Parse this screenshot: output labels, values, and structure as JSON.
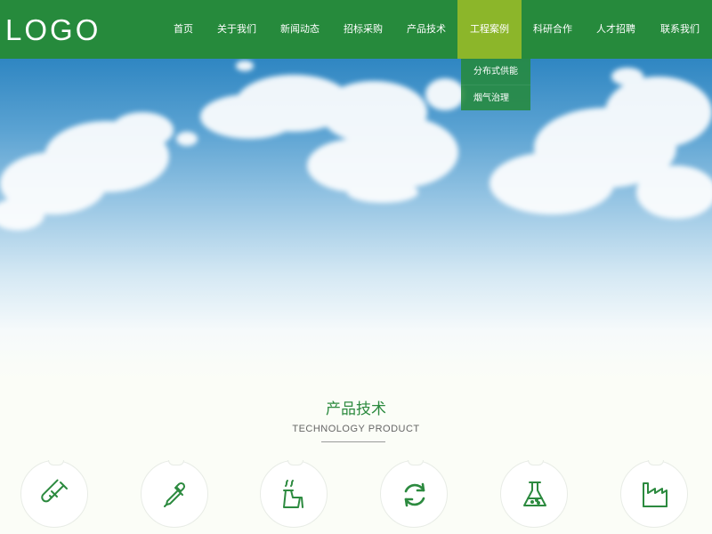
{
  "header": {
    "logo": "LOGO",
    "nav": [
      {
        "label": "首页"
      },
      {
        "label": "关于我们"
      },
      {
        "label": "新闻动态"
      },
      {
        "label": "招标采购"
      },
      {
        "label": "产品技术"
      },
      {
        "label": "工程案例",
        "active": true
      },
      {
        "label": "科研合作"
      },
      {
        "label": "人才招聘"
      },
      {
        "label": "联系我们"
      }
    ]
  },
  "dropdown": {
    "items": [
      "分布式供能",
      "烟气治理"
    ]
  },
  "section": {
    "title": "产品技术",
    "subtitle": "TECHNOLOGY PRODUCT",
    "icons": [
      "test-tube-icon",
      "dropper-icon",
      "factory-chimney-icon",
      "recycle-arrows-icon",
      "flask-icon",
      "factory-icon"
    ]
  },
  "colors": {
    "brand_green": "#268a3c",
    "active_nav": "#8cb62a",
    "icon_green": "#2c8a3f"
  }
}
